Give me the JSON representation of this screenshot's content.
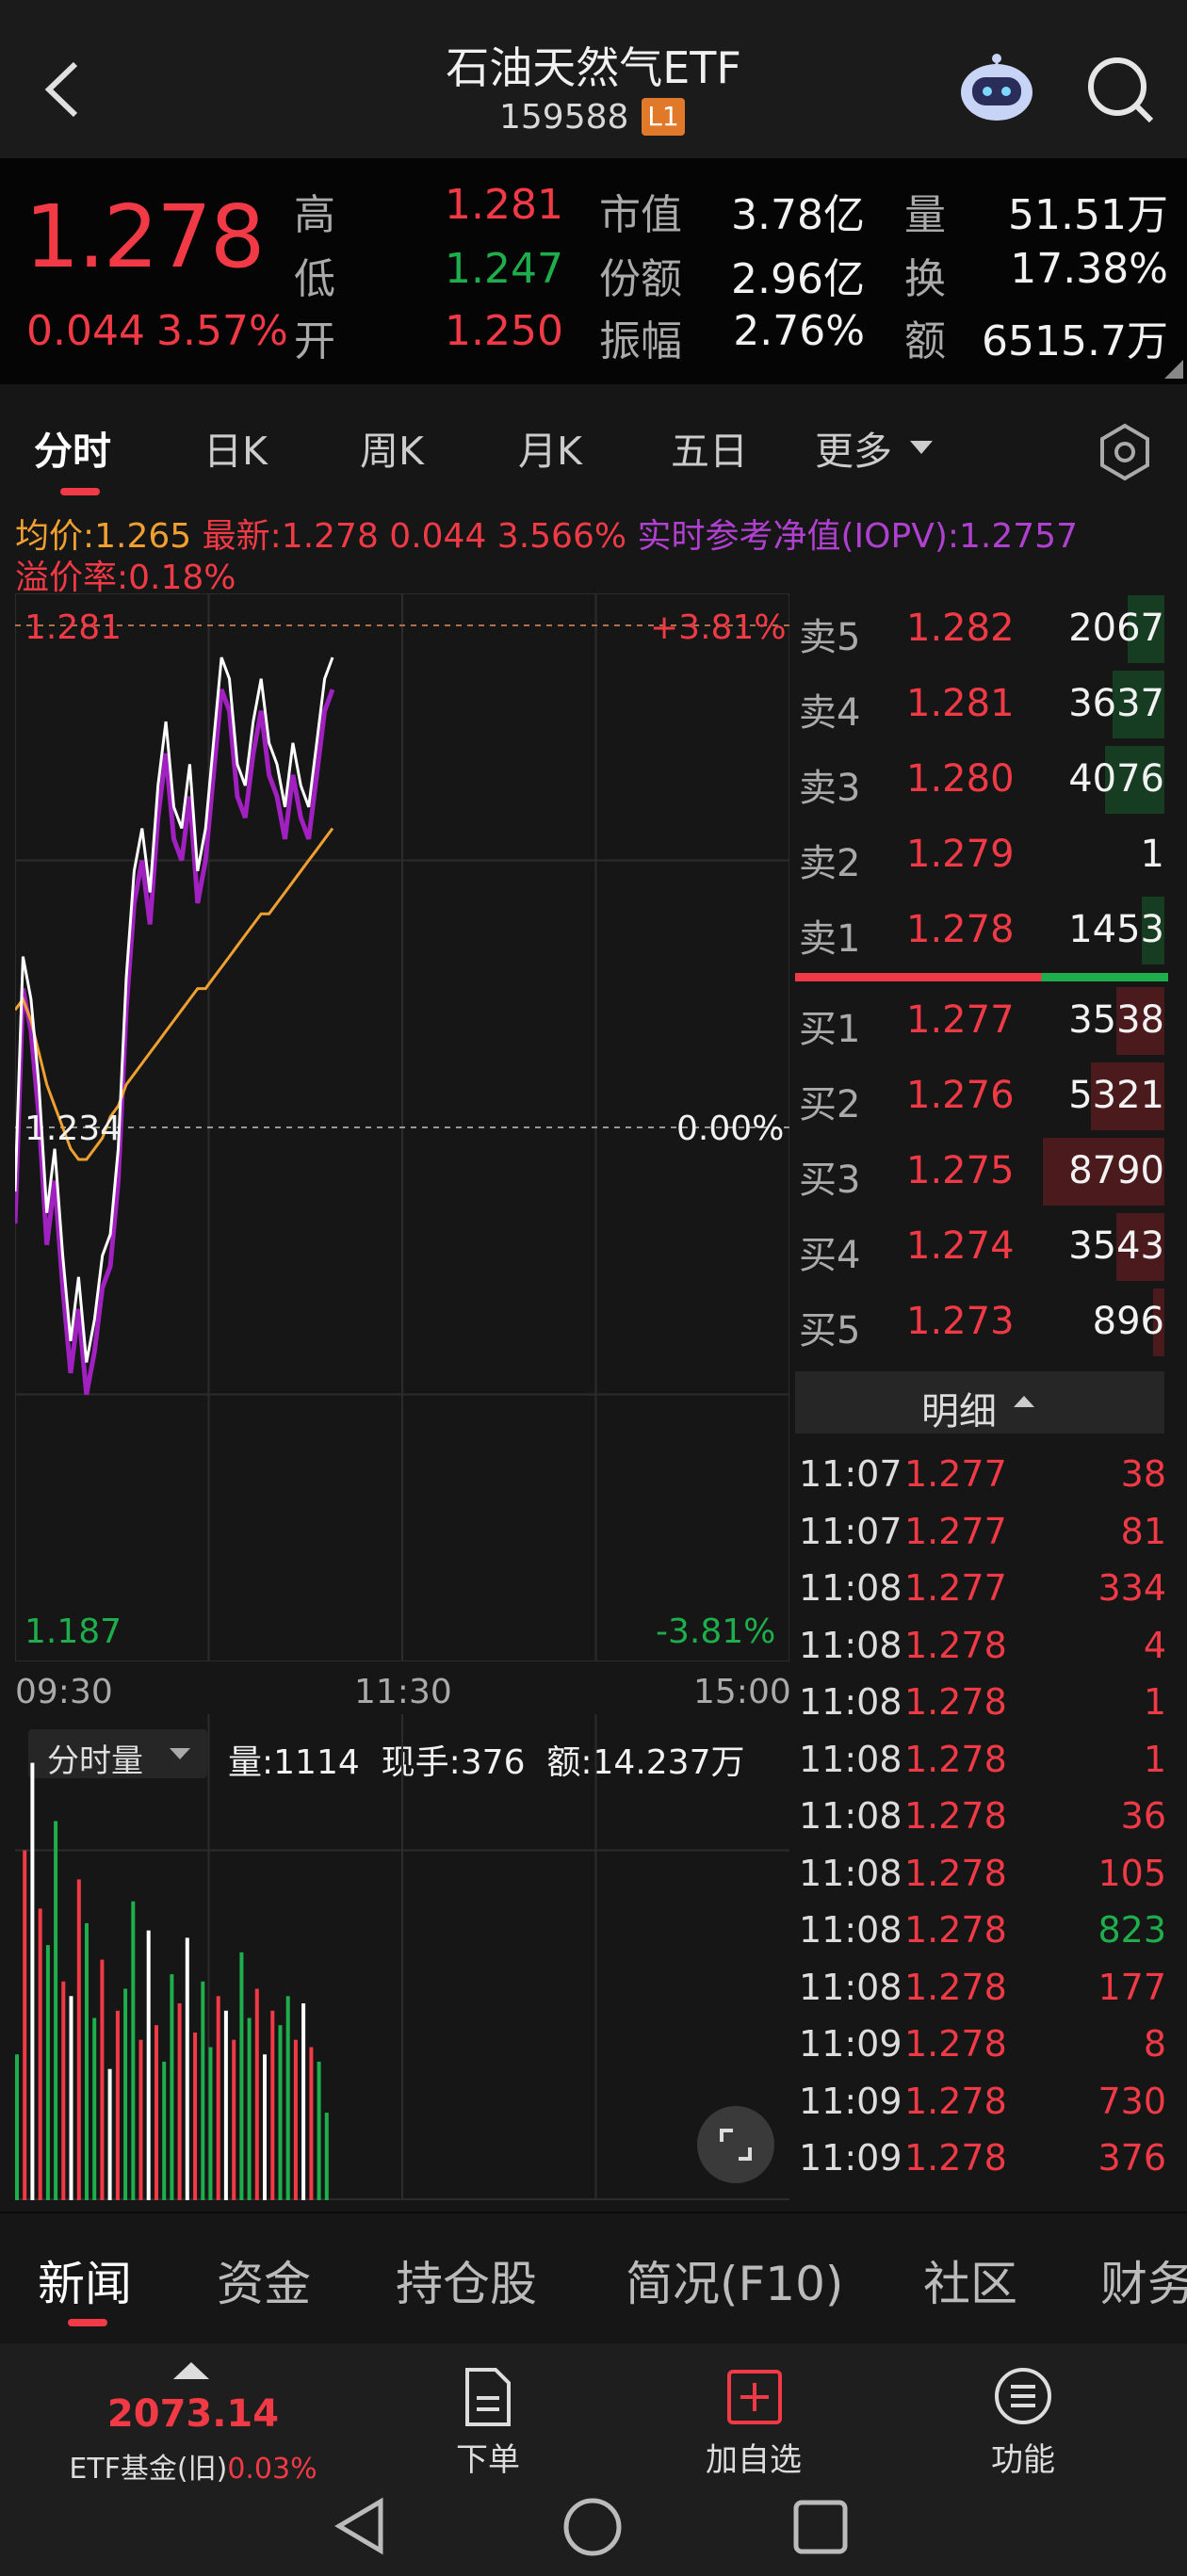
{
  "header": {
    "title": "石油天然气ETF",
    "code": "159588",
    "level_badge": "L1"
  },
  "quote": {
    "price": "1.278",
    "change": "0.044",
    "change_pct": "3.57%",
    "high_label": "高",
    "high": "1.281",
    "low_label": "低",
    "low": "1.247",
    "open_label": "开",
    "open": "1.250",
    "mktcap_label": "市值",
    "mktcap": "3.78亿",
    "shares_label": "份额",
    "shares": "2.96亿",
    "amp_label": "振幅",
    "amp": "2.76%",
    "vol_label": "量",
    "vol": "51.51万",
    "turn_label": "换",
    "turn": "17.38%",
    "amt_label": "额",
    "amt": "6515.7万"
  },
  "chart_tabs": [
    "分时",
    "日K",
    "周K",
    "月K",
    "五日",
    "更多"
  ],
  "info": {
    "avg": "均价:1.265",
    "latest": "最新:1.278 0.044 3.566%",
    "iopv": "实时参考净值(IOPV):1.2757",
    "premium": "溢价率:0.18%"
  },
  "chart_labels": {
    "top_price": "1.281",
    "top_pct": "+3.81%",
    "mid_price": "1.234",
    "mid_pct": "0.00%",
    "bot_price": "1.187",
    "bot_pct": "-3.81%",
    "t_start": "09:30",
    "t_mid": "11:30",
    "t_end": "15:00"
  },
  "chart_data": {
    "type": "line",
    "title": "",
    "x_range": [
      "09:30",
      "15:00"
    ],
    "ylim": [
      1.187,
      1.281
    ],
    "prev_close": 1.234,
    "series": [
      {
        "name": "最新",
        "color": "#ffffff",
        "values": [
          1.228,
          1.25,
          1.246,
          1.238,
          1.226,
          1.232,
          1.222,
          1.214,
          1.22,
          1.212,
          1.216,
          1.222,
          1.224,
          1.232,
          1.248,
          1.258,
          1.262,
          1.256,
          1.266,
          1.272,
          1.264,
          1.262,
          1.268,
          1.258,
          1.262,
          1.27,
          1.278,
          1.276,
          1.268,
          1.266,
          1.272,
          1.276,
          1.27,
          1.268,
          1.264,
          1.27,
          1.266,
          1.264,
          1.27,
          1.276,
          1.278
        ]
      },
      {
        "name": "均价",
        "color": "#f0a030",
        "values": [
          1.245,
          1.246,
          1.244,
          1.241,
          1.238,
          1.236,
          1.234,
          1.232,
          1.231,
          1.231,
          1.232,
          1.233,
          1.235,
          1.236,
          1.238,
          1.239,
          1.24,
          1.241,
          1.242,
          1.243,
          1.244,
          1.245,
          1.246,
          1.247,
          1.247,
          1.248,
          1.249,
          1.25,
          1.251,
          1.252,
          1.253,
          1.254,
          1.254,
          1.255,
          1.256,
          1.257,
          1.258,
          1.259,
          1.26,
          1.261,
          1.262
        ]
      }
    ],
    "volume": [
      20,
      48,
      60,
      40,
      35,
      52,
      30,
      28,
      44,
      38,
      25,
      33,
      18,
      26,
      29,
      41,
      22,
      37,
      24,
      19,
      31,
      27,
      36,
      23,
      30,
      21,
      28,
      26,
      22,
      34,
      25,
      29,
      20,
      26,
      24,
      28,
      22,
      27,
      21,
      19,
      12
    ]
  },
  "volume_panel": {
    "selector": "分时量",
    "vol": "量:1114",
    "hand": "现手:376",
    "amt": "额:14.237万"
  },
  "orderbook": {
    "asks": [
      {
        "label": "卖5",
        "price": "1.282",
        "vol": "2067",
        "w": 0.1
      },
      {
        "label": "卖4",
        "price": "1.281",
        "vol": "3637",
        "w": 0.14
      },
      {
        "label": "卖3",
        "price": "1.280",
        "vol": "4076",
        "w": 0.16
      },
      {
        "label": "卖2",
        "price": "1.279",
        "vol": "1",
        "w": 0.0
      },
      {
        "label": "卖1",
        "price": "1.278",
        "vol": "1453",
        "w": 0.06
      }
    ],
    "bids": [
      {
        "label": "买1",
        "price": "1.277",
        "vol": "3538",
        "w": 0.13
      },
      {
        "label": "买2",
        "price": "1.276",
        "vol": "5321",
        "w": 0.2
      },
      {
        "label": "买3",
        "price": "1.275",
        "vol": "8790",
        "w": 0.33
      },
      {
        "label": "买4",
        "price": "1.274",
        "vol": "3543",
        "w": 0.13
      },
      {
        "label": "买5",
        "price": "1.273",
        "vol": "896",
        "w": 0.03
      }
    ]
  },
  "detail_label": "明细",
  "ticks": [
    {
      "t": "11:07",
      "p": "1.277",
      "v": "38",
      "c": "red"
    },
    {
      "t": "11:07",
      "p": "1.277",
      "v": "81",
      "c": "red"
    },
    {
      "t": "11:08",
      "p": "1.277",
      "v": "334",
      "c": "red"
    },
    {
      "t": "11:08",
      "p": "1.278",
      "v": "4",
      "c": "red"
    },
    {
      "t": "11:08",
      "p": "1.278",
      "v": "1",
      "c": "red"
    },
    {
      "t": "11:08",
      "p": "1.278",
      "v": "1",
      "c": "red"
    },
    {
      "t": "11:08",
      "p": "1.278",
      "v": "36",
      "c": "red"
    },
    {
      "t": "11:08",
      "p": "1.278",
      "v": "105",
      "c": "red"
    },
    {
      "t": "11:08",
      "p": "1.278",
      "v": "823",
      "c": "green"
    },
    {
      "t": "11:08",
      "p": "1.278",
      "v": "177",
      "c": "red"
    },
    {
      "t": "11:09",
      "p": "1.278",
      "v": "8",
      "c": "red"
    },
    {
      "t": "11:09",
      "p": "1.278",
      "v": "730",
      "c": "red"
    },
    {
      "t": "11:09",
      "p": "1.278",
      "v": "376",
      "c": "red"
    }
  ],
  "bottom_tabs": [
    "新闻",
    "资金",
    "持仓股",
    "简况(F10)",
    "社区",
    "财务"
  ],
  "bottom_bar": {
    "index_value": "2073.14",
    "index_name": "ETF基金(旧)",
    "index_pct": "0.03%",
    "order": "下单",
    "add": "加自选",
    "func": "功能"
  }
}
